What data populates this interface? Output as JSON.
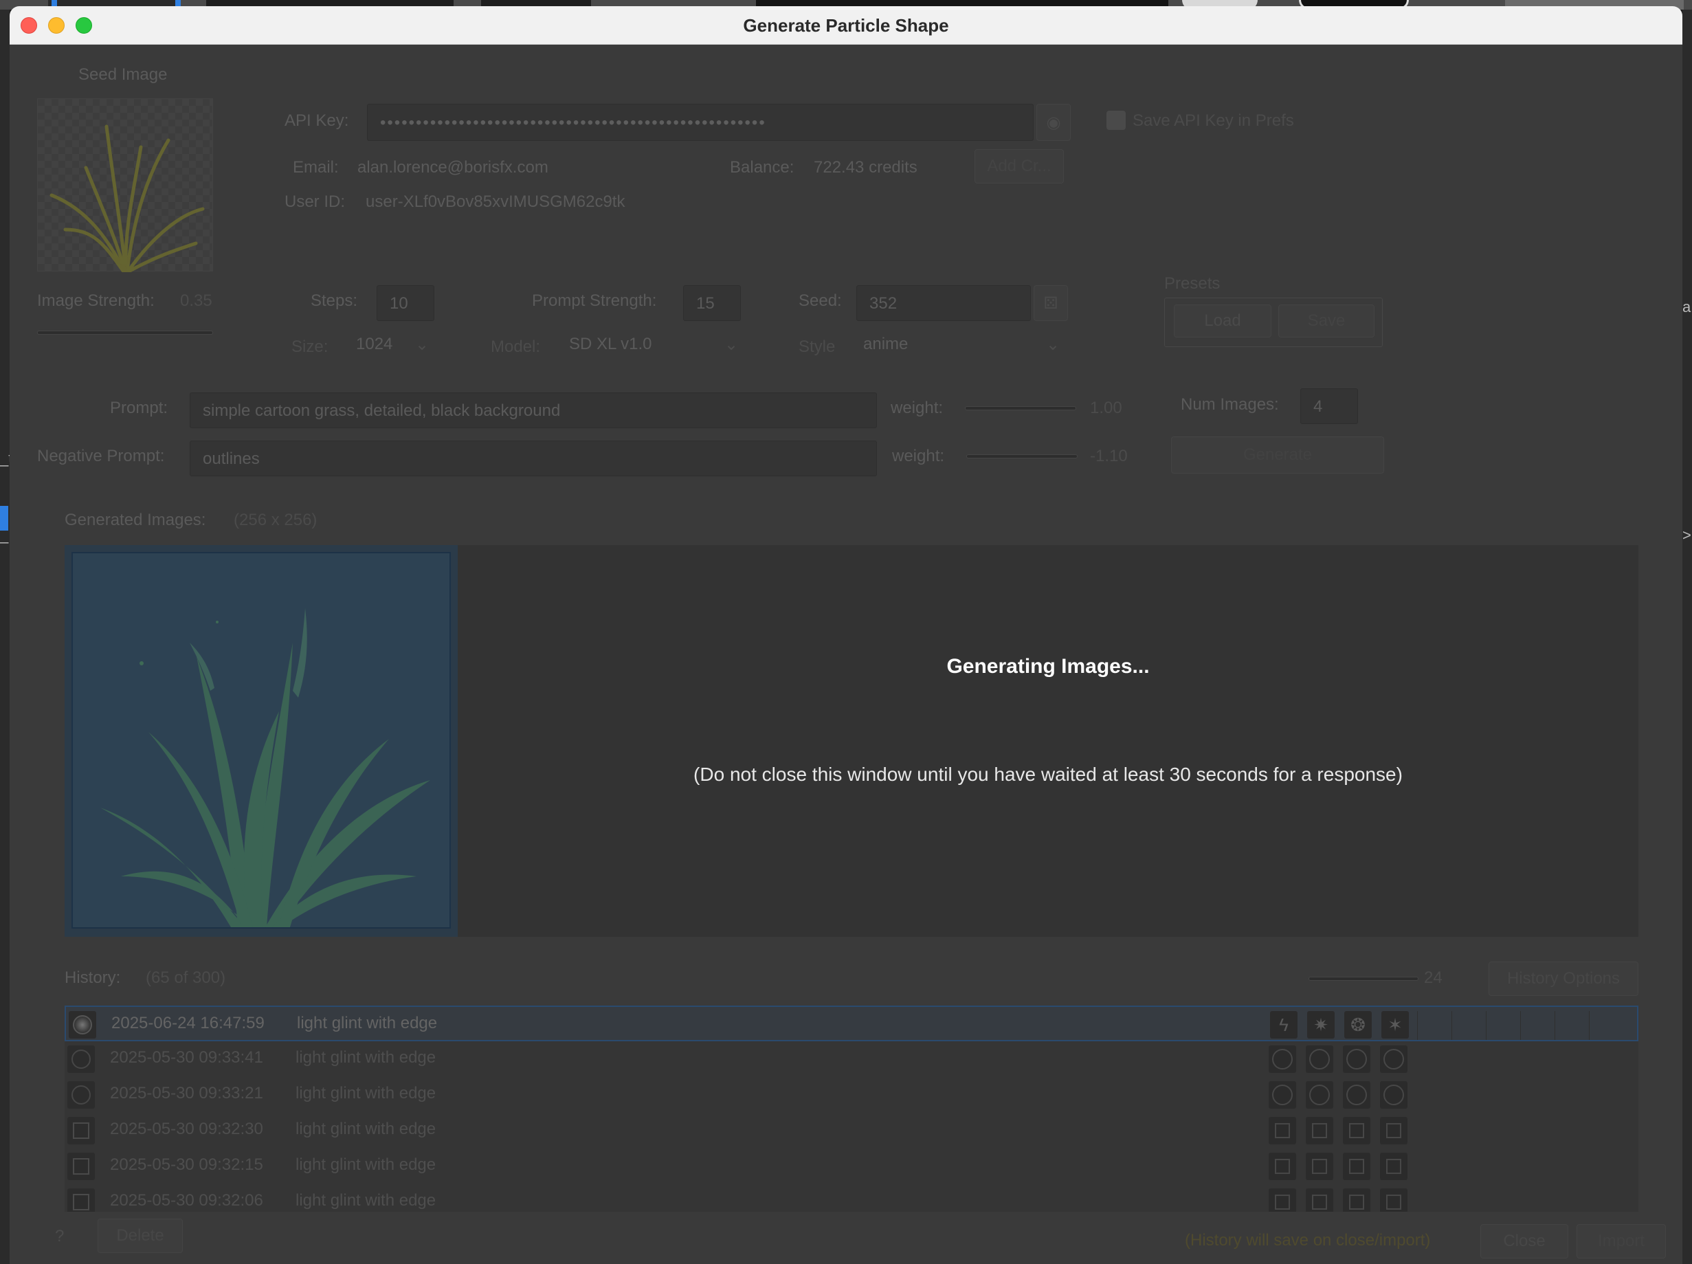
{
  "window": {
    "title": "Generate Particle Shape"
  },
  "colors": {
    "close": "#ff5f57",
    "minimize": "#febc2e",
    "zoom": "#28c840",
    "selection": "#2a4a6e"
  },
  "outside": {
    "left_text_1": "_t",
    "left_text_2": "_",
    "right_text_1": "a",
    "right_text_2": ">"
  },
  "seed": {
    "label": "Seed Image",
    "image_strength_label": "Image Strength:",
    "image_strength_value": "0.35"
  },
  "api": {
    "key_label": "API Key:",
    "key_value": "••••••••••••••••••••••••••••••••••••••••••••••••••••••",
    "save_label": "Save API Key in Prefs",
    "email_label": "Email:",
    "email_value": "alan.lorence@borisfx.com",
    "balance_label": "Balance:",
    "balance_value": "722.43 credits",
    "add_button": "Add Cr...",
    "userid_label": "User ID:",
    "userid_value": "user-XLf0vBov85xvIMUSGM62c9tk"
  },
  "params": {
    "steps_label": "Steps:",
    "steps_value": "10",
    "prompt_strength_label": "Prompt Strength:",
    "prompt_strength_value": "15",
    "seed_label": "Seed:",
    "seed_value": "352",
    "size_label": "Size:",
    "size_value": "1024",
    "model_label": "Model:",
    "model_value": "SD XL v1.0",
    "style_label": "Style",
    "style_value": "anime"
  },
  "presets": {
    "label": "Presets",
    "load": "Load",
    "save": "Save"
  },
  "prompt": {
    "label": "Prompt:",
    "value": "simple cartoon grass, detailed, black background",
    "weight_label": "weight:",
    "weight_value": "1.00",
    "num_images_label": "Num Images:",
    "num_images_value": "4"
  },
  "negative": {
    "label": "Negative Prompt:",
    "value": "outlines",
    "weight_label": "weight:",
    "weight_value": "-1.10",
    "generate_button": "Generate"
  },
  "generated": {
    "label": "Generated Images:",
    "size": "(256 x 256)",
    "status_title": "Generating Images...",
    "status_note": "(Do not close this window until you have waited at least 30 seconds for a response)"
  },
  "history": {
    "label": "History:",
    "count": "(65 of 300)",
    "slider_value": "24",
    "options_button": "History Options",
    "rows": [
      {
        "date": "2025-06-24 16:47:59",
        "prompt": "light glint with edge",
        "icon": "glint-thumb",
        "mini": [
          "star",
          "star",
          "star",
          "star"
        ]
      },
      {
        "date": "2025-05-30 09:33:41",
        "prompt": "light glint with edge",
        "icon": "ring-thumb",
        "mini": [
          "ring",
          "ring",
          "ring",
          "ring"
        ]
      },
      {
        "date": "2025-05-30 09:33:21",
        "prompt": "light glint with edge",
        "icon": "ring-thumb",
        "mini": [
          "ring",
          "ring",
          "ring",
          "ring"
        ]
      },
      {
        "date": "2025-05-30 09:32:30",
        "prompt": "light glint with edge",
        "icon": "square-thumb",
        "mini": [
          "sq",
          "sq",
          "sq",
          "sq"
        ]
      },
      {
        "date": "2025-05-30 09:32:15",
        "prompt": "light glint with edge",
        "icon": "square-thumb",
        "mini": [
          "sq",
          "sq",
          "sq",
          "sq"
        ]
      },
      {
        "date": "2025-05-30 09:32:06",
        "prompt": "light glint with edge",
        "icon": "square-thumb",
        "mini": [
          "sq",
          "sq",
          "sq",
          "sq"
        ]
      }
    ]
  },
  "footer": {
    "help": "?",
    "delete": "Delete",
    "note": "(History will save on close/import)",
    "close": "Close",
    "import": "Import"
  }
}
